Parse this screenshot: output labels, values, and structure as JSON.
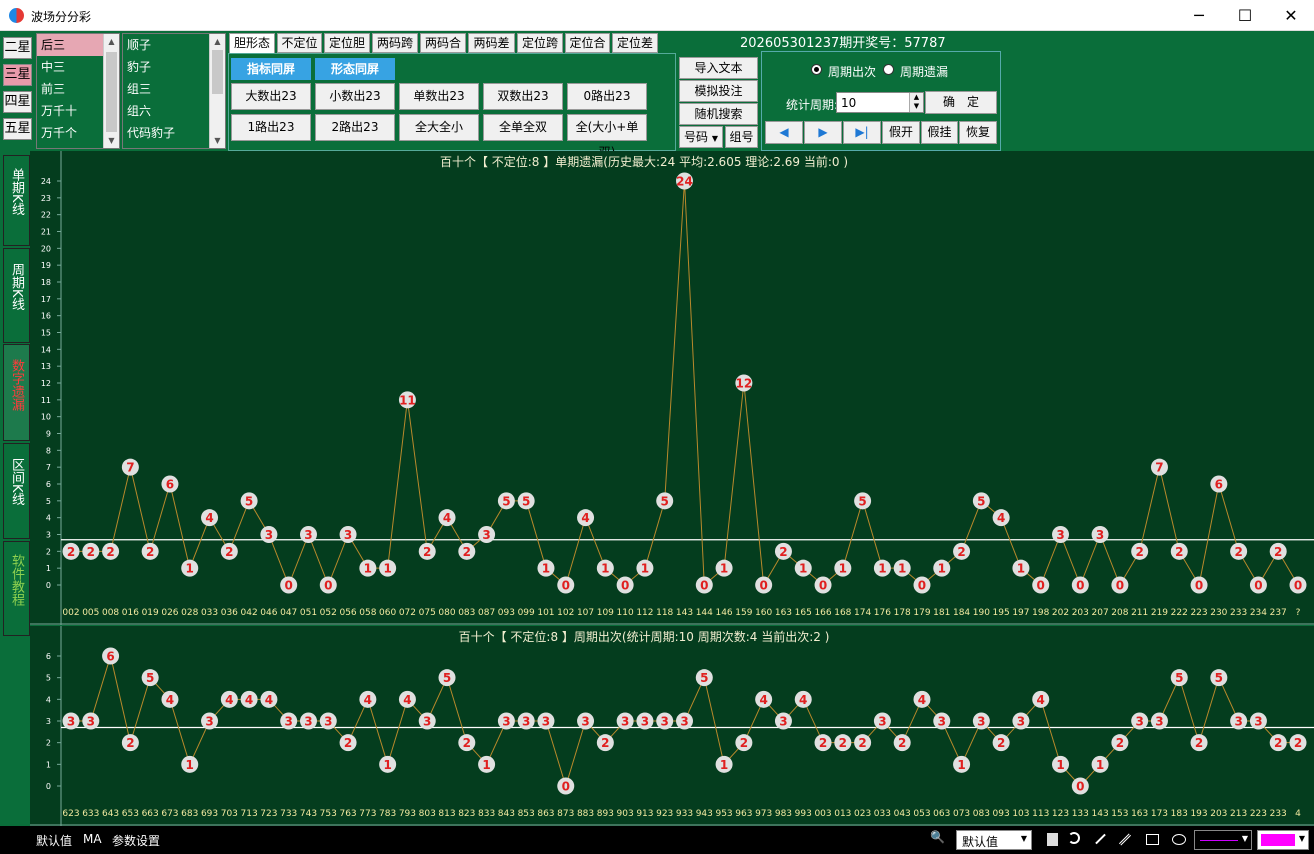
{
  "window": {
    "title": "波场分分彩",
    "minimize_icon": "─",
    "maximize_icon": "☐",
    "close_icon": "✕"
  },
  "stars": [
    "二星",
    "三星",
    "四星",
    "五星"
  ],
  "selected_star": 1,
  "position_list": {
    "items": [
      "后三",
      "中三",
      "前三",
      "万千十",
      "万千个"
    ],
    "selected": 0
  },
  "pattern_list": {
    "items": [
      "顺子",
      "豹子",
      "组三",
      "组六",
      "代码豹子"
    ]
  },
  "tabs": [
    "胆形态",
    "不定位",
    "定位胆",
    "两码跨",
    "两码合",
    "两码差",
    "定位跨",
    "定位合",
    "定位差"
  ],
  "selected_tab": 0,
  "sync_buttons": [
    "指标同屏",
    "形态同屏"
  ],
  "filter_buttons": [
    "大数出23",
    "小数出23",
    "单数出23",
    "双数出23",
    "0路出23",
    "1路出23",
    "2路出23",
    "全大全小",
    "全单全双",
    "全(大小+单双)"
  ],
  "action_buttons": {
    "import": "导入文本",
    "simulate": "模拟投注",
    "random": "随机搜索",
    "code": "号码",
    "group": "组号"
  },
  "draw_info": "202605301237期开奖号：57787",
  "right_panel": {
    "radio1": "周期出次",
    "radio2": "周期遗漏",
    "stat_label": "统计周期:",
    "stat_value": "10",
    "confirm": "确　定",
    "prev_icon": "◀",
    "next_icon": "▶",
    "end_icon": "▶|",
    "hide1": "假开",
    "hide2": "假挂",
    "restore": "恢复"
  },
  "side_tabs": [
    "单期K线",
    "周期K线",
    "数字遗漏",
    "区间K线",
    "软件教程"
  ],
  "selected_side": 2,
  "chart_data": [
    {
      "type": "line",
      "title": "百十个【 不定位:8 】单期遗漏(历史最大:24 平均:2.605 理论:2.69 当前:0 )",
      "ylim": [
        0,
        24
      ],
      "yticks": [
        0,
        1,
        2,
        3,
        4,
        5,
        6,
        7,
        8,
        9,
        10,
        11,
        12,
        13,
        14,
        15,
        16,
        17,
        18,
        19,
        20,
        21,
        22,
        23,
        24
      ],
      "reference_line": 2.69,
      "x": [
        "002",
        "005",
        "008",
        "016",
        "019",
        "026",
        "028",
        "033",
        "036",
        "042",
        "046",
        "047",
        "051",
        "052",
        "056",
        "058",
        "060",
        "072",
        "075",
        "080",
        "083",
        "087",
        "093",
        "099",
        "101",
        "102",
        "107",
        "109",
        "110",
        "112",
        "118",
        "143",
        "144",
        "146",
        "159",
        "160",
        "163",
        "165",
        "166",
        "168",
        "174",
        "176",
        "178",
        "179",
        "181",
        "184",
        "190",
        "195",
        "197",
        "198",
        "202",
        "203",
        "207",
        "208",
        "211",
        "219",
        "222",
        "223",
        "230",
        "233",
        "234",
        "237",
        "?"
      ],
      "values": [
        2,
        2,
        2,
        7,
        2,
        6,
        1,
        4,
        2,
        5,
        3,
        0,
        3,
        0,
        3,
        1,
        1,
        11,
        2,
        4,
        2,
        3,
        5,
        5,
        1,
        0,
        4,
        1,
        0,
        1,
        5,
        24,
        0,
        1,
        12,
        0,
        2,
        1,
        0,
        1,
        5,
        1,
        1,
        0,
        1,
        2,
        5,
        4,
        1,
        0,
        3,
        0,
        3,
        0,
        2,
        7,
        2,
        0,
        6,
        2,
        0,
        2,
        0
      ]
    },
    {
      "type": "line",
      "title": "百十个【 不定位:8 】周期出次(统计周期:10 周期次数:4 当前出次:2 )",
      "ylim": [
        0,
        6
      ],
      "yticks": [
        0,
        1,
        2,
        3,
        4,
        5,
        6
      ],
      "reference_line": 2.7,
      "x": [
        "623",
        "633",
        "643",
        "653",
        "663",
        "673",
        "683",
        "693",
        "703",
        "713",
        "723",
        "733",
        "743",
        "753",
        "763",
        "773",
        "783",
        "793",
        "803",
        "813",
        "823",
        "833",
        "843",
        "853",
        "863",
        "873",
        "883",
        "893",
        "903",
        "913",
        "923",
        "933",
        "943",
        "953",
        "963",
        "973",
        "983",
        "993",
        "003",
        "013",
        "023",
        "033",
        "043",
        "053",
        "063",
        "073",
        "083",
        "093",
        "103",
        "113",
        "123",
        "133",
        "143",
        "153",
        "163",
        "173",
        "183",
        "193",
        "203",
        "213",
        "223",
        "233",
        "4"
      ],
      "values": [
        3,
        3,
        6,
        2,
        5,
        4,
        1,
        3,
        4,
        4,
        4,
        3,
        3,
        3,
        2,
        4,
        1,
        4,
        3,
        5,
        2,
        1,
        3,
        3,
        3,
        0,
        3,
        2,
        3,
        3,
        3,
        3,
        5,
        1,
        2,
        4,
        3,
        4,
        2,
        2,
        2,
        3,
        2,
        4,
        3,
        1,
        3,
        2,
        3,
        4,
        1,
        0,
        1,
        2,
        3,
        3,
        5,
        2,
        5,
        3,
        3,
        2,
        2
      ]
    }
  ],
  "bottom_bar": {
    "default_label": "默认值",
    "ma": "MA",
    "params": "参数设置",
    "select_value": "默认值",
    "zoom_icon": "🔍"
  },
  "colors": {
    "background": "#0a6e3a",
    "chart_bg": "#043d1e",
    "point_fill": "#e0e0e0",
    "point_text": "#e02020",
    "line": "#b8892c",
    "ref_line": "#ffffff",
    "tick_text": "#f2e9a0",
    "magenta": "#ff00ff"
  }
}
